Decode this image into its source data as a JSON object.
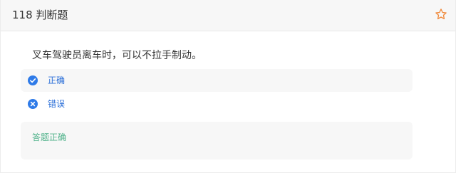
{
  "header": {
    "title": "118 判断题",
    "favorite_icon": "star-outline-icon"
  },
  "question": {
    "text": "叉车驾驶员离车时，可以不拉手制动。"
  },
  "options": [
    {
      "label": "正确",
      "icon": "check-circle-icon"
    },
    {
      "label": "错误",
      "icon": "x-circle-icon"
    }
  ],
  "result": {
    "text": "答题正确"
  },
  "colors": {
    "accent_blue": "#2b6fd8",
    "icon_blue": "#2f7be8",
    "star_orange": "#f08a3c",
    "result_green": "#4fb28a",
    "panel_bg": "#f7f7f7"
  }
}
